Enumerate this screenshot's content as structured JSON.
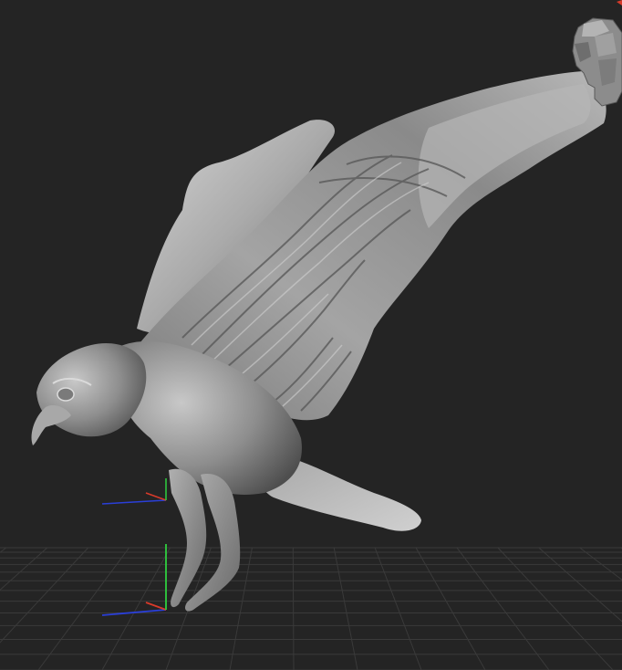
{
  "viewport": {
    "background": "#242424",
    "grid_color": "#3a3a3a",
    "axis_x_color": "#2a3fd8",
    "axis_y_color": "#2fcf3f",
    "axis_z_color": "#d83a2a",
    "gizmo_face_color": "#8c8c8c"
  },
  "model": {
    "name": "",
    "material_color": "#9a9a9a",
    "highlight_color": "#d8d8d8",
    "shadow_color": "#4a4a4a"
  },
  "icons": {
    "navigation_gizmo": "head-gizmo-icon",
    "axis_indicator": "axis-arrows-icon"
  }
}
